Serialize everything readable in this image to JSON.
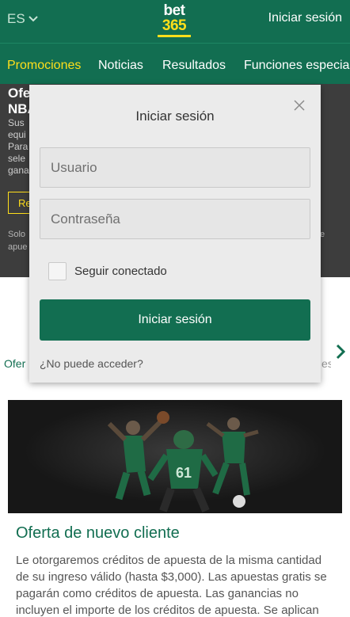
{
  "header": {
    "language": "ES",
    "logo_top": "bet",
    "logo_bottom": "365",
    "login_link": "Iniciar sesión"
  },
  "nav": {
    "items": [
      "Promociones",
      "Noticias",
      "Resultados",
      "Funciones especiales"
    ]
  },
  "background": {
    "hero_title_1": "Ofe",
    "hero_title_2": "NBA",
    "hero_lines": [
      "Sus",
      "equi",
      "Para",
      "sele",
      "gana"
    ],
    "hero_button": "Re",
    "hero_foot_1": "Solo",
    "hero_foot_2": "apue",
    "hero_foot_right": "e",
    "tab_left": "Ofer",
    "tab_right": "es",
    "promo_title": "Oferta de nuevo cliente",
    "promo_text": "Le otorgaremos créditos de apuesta de la misma cantidad de su ingreso válido (hasta $3,000). Las apuestas gratis se pagarán como créditos de apuesta. Las ganancias no incluyen el importe de los créditos de apuesta. Se aplican"
  },
  "modal": {
    "title": "Iniciar sesión",
    "username_placeholder": "Usuario",
    "password_placeholder": "Contraseña",
    "remember_label": "Seguir conectado",
    "submit_label": "Iniciar sesión",
    "forgot_label": "¿No puede acceder?"
  },
  "colors": {
    "brand_green": "#126e51",
    "brand_yellow": "#ffdf1b"
  }
}
